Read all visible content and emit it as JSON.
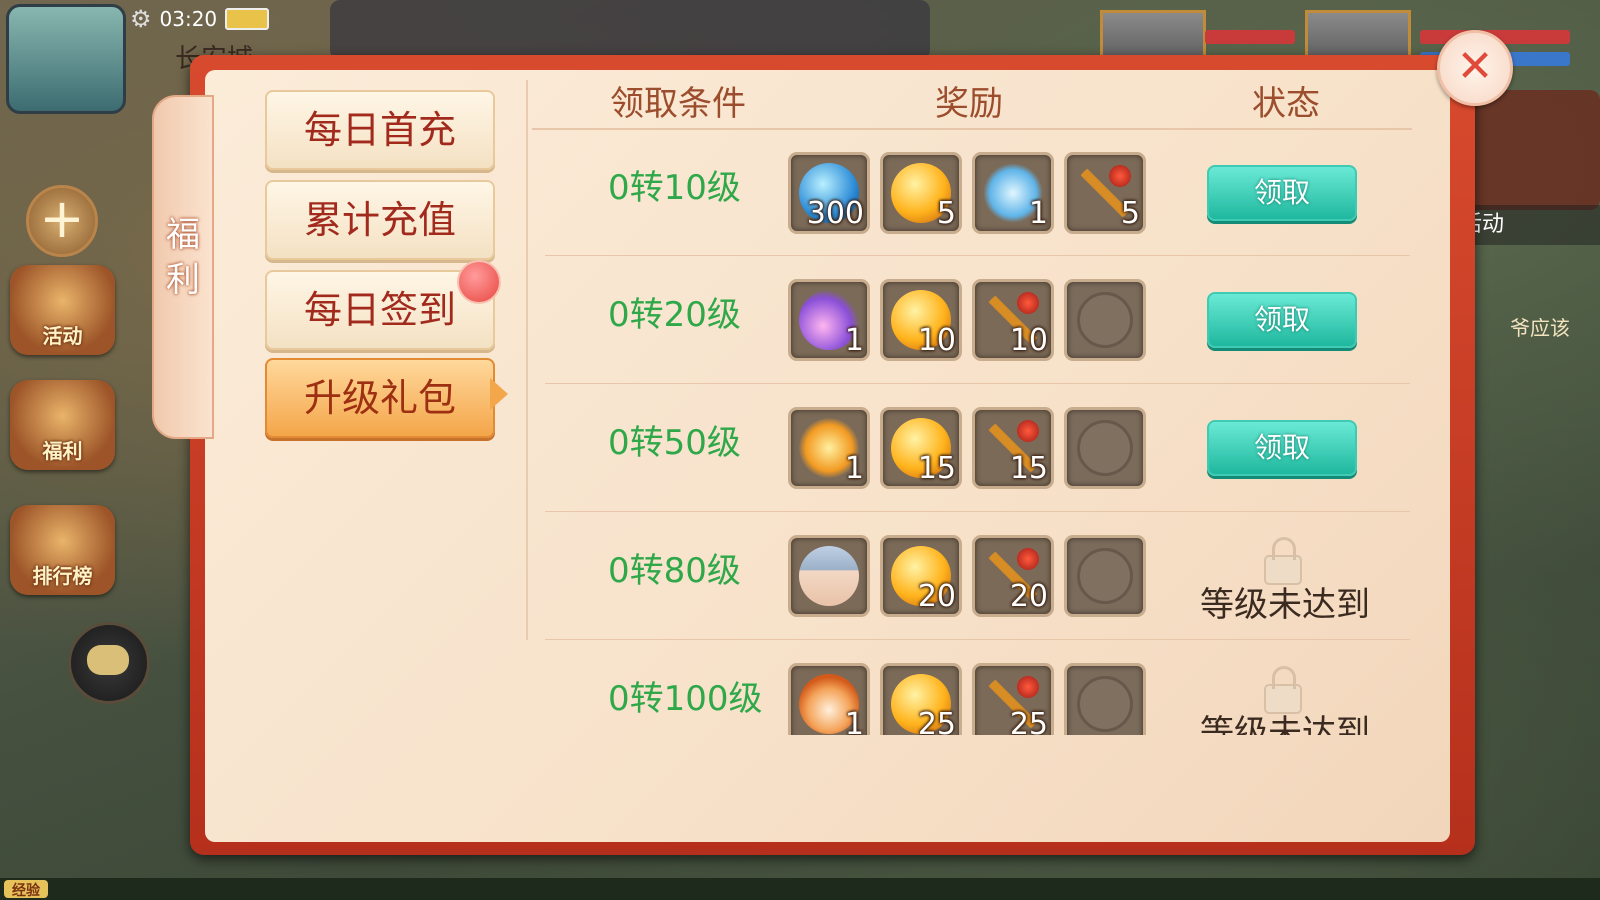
{
  "status_bar": {
    "time": "03:20"
  },
  "hud": {
    "location_partial": "长安城",
    "right_activity_label": "活动",
    "right_hint_text": "爷应该",
    "left_buttons": [
      {
        "label": "活动"
      },
      {
        "label": "福利"
      },
      {
        "label": "排行榜"
      }
    ],
    "exp_label": "经验"
  },
  "panel": {
    "side_tag": [
      "福",
      "利"
    ],
    "tabs": [
      {
        "label": "每日首充",
        "active": false
      },
      {
        "label": "累计充值",
        "active": false
      },
      {
        "label": "每日签到",
        "active": false,
        "has_notification": true
      },
      {
        "label": "升级礼包",
        "active": true
      }
    ],
    "columns": {
      "condition": "领取条件",
      "reward": "奖励",
      "status": "状态"
    },
    "rows": [
      {
        "condition": "0转10级",
        "rewards": [
          {
            "icon": "blue-orb-icon",
            "count": "300"
          },
          {
            "icon": "gold-orb-icon",
            "count": "5"
          },
          {
            "icon": "ice-wing-icon",
            "count": "1"
          },
          {
            "icon": "golden-staff-icon",
            "count": "5"
          }
        ],
        "status": {
          "type": "claim",
          "label": "领取"
        }
      },
      {
        "condition": "0转20级",
        "rewards": [
          {
            "icon": "meteor-icon",
            "count": "1"
          },
          {
            "icon": "gold-orb-icon",
            "count": "10"
          },
          {
            "icon": "golden-staff-icon",
            "count": "10"
          },
          {
            "icon": "empty-slot",
            "count": ""
          }
        ],
        "status": {
          "type": "claim",
          "label": "领取"
        }
      },
      {
        "condition": "0转50级",
        "rewards": [
          {
            "icon": "fire-feather-icon",
            "count": "1"
          },
          {
            "icon": "gold-orb-icon",
            "count": "15"
          },
          {
            "icon": "golden-staff-icon",
            "count": "15"
          },
          {
            "icon": "empty-slot",
            "count": ""
          }
        ],
        "status": {
          "type": "claim",
          "label": "领取"
        }
      },
      {
        "condition": "0转80级",
        "rewards": [
          {
            "icon": "armored-hero-portrait",
            "count": ""
          },
          {
            "icon": "gold-orb-icon",
            "count": "20"
          },
          {
            "icon": "golden-staff-icon",
            "count": "20"
          },
          {
            "icon": "empty-slot",
            "count": ""
          }
        ],
        "status": {
          "type": "locked",
          "label": "等级未达到"
        }
      },
      {
        "condition": "0转100级",
        "rewards": [
          {
            "icon": "fox-pet-portrait",
            "count": "1"
          },
          {
            "icon": "gold-orb-icon",
            "count": "25"
          },
          {
            "icon": "golden-staff-icon",
            "count": "25"
          },
          {
            "icon": "empty-slot",
            "count": ""
          }
        ],
        "status": {
          "type": "locked",
          "label": "等级未达到"
        }
      }
    ]
  },
  "colors": {
    "level_text": "#2fa84a",
    "claim_button": "#1fb89e",
    "tab_active": "#f4a64a",
    "frame_red": "#d84a2e"
  }
}
